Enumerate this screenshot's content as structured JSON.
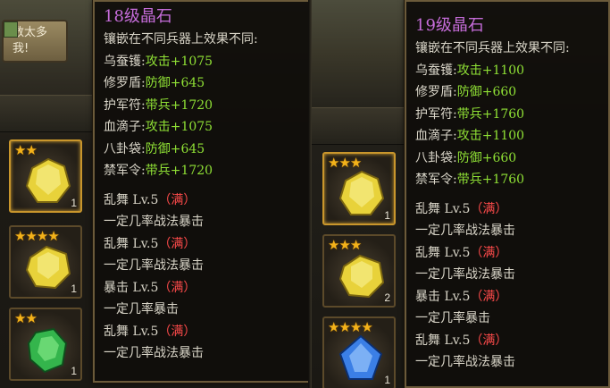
{
  "left": {
    "chat_text": "数太多我!",
    "tooltip": {
      "title": "18级晶石",
      "desc": "镶嵌在不同兵器上效果不同:",
      "effects": [
        {
          "name": "乌蚕镬:",
          "value": "攻击+1075"
        },
        {
          "name": "修罗盾:",
          "value": "防御+645"
        },
        {
          "name": "护军符:",
          "value": "带兵+1720"
        },
        {
          "name": "血滴子:",
          "value": "攻击+1075"
        },
        {
          "name": "八卦袋:",
          "value": "防御+645"
        },
        {
          "name": "禁军令:",
          "value": "带兵+1720"
        }
      ],
      "skills": [
        {
          "name": "乱舞 Lv.5",
          "full": "（满）",
          "desc": "一定几率战法暴击"
        },
        {
          "name": "乱舞 Lv.5",
          "full": "（满）",
          "desc": "一定几率战法暴击"
        },
        {
          "name": "暴击 Lv.5",
          "full": "（满）",
          "desc": "一定几率暴击"
        },
        {
          "name": "乱舞 Lv.5",
          "full": "（满）",
          "desc": "一定几率战法暴击"
        }
      ]
    },
    "slots": [
      {
        "stars": "★★",
        "count": "1",
        "gem": "yellow-gem-icon",
        "color": "#e8d23a"
      },
      {
        "stars": "★★★★",
        "count": "1",
        "gem": "yellow-gem-icon",
        "color": "#e8d23a"
      },
      {
        "stars": "★★",
        "count": "1",
        "gem": "green-gem-icon",
        "color": "#34b54c"
      }
    ]
  },
  "right": {
    "tooltip": {
      "title": "19级晶石",
      "desc": "镶嵌在不同兵器上效果不同:",
      "effects": [
        {
          "name": "乌蚕镬:",
          "value": "攻击+1100"
        },
        {
          "name": "修罗盾:",
          "value": "防御+660"
        },
        {
          "name": "护军符:",
          "value": "带兵+1760"
        },
        {
          "name": "血滴子:",
          "value": "攻击+1100"
        },
        {
          "name": "八卦袋:",
          "value": "防御+660"
        },
        {
          "name": "禁军令:",
          "value": "带兵+1760"
        }
      ],
      "skills": [
        {
          "name": "乱舞 Lv.5",
          "full": "（满）",
          "desc": "一定几率战法暴击"
        },
        {
          "name": "乱舞 Lv.5",
          "full": "（满）",
          "desc": "一定几率战法暴击"
        },
        {
          "name": "暴击 Lv.5",
          "full": "（满）",
          "desc": "一定几率暴击"
        },
        {
          "name": "乱舞 Lv.5",
          "full": "（满）",
          "desc": "一定几率战法暴击"
        }
      ]
    },
    "slots": [
      {
        "stars": "★★★",
        "count": "1",
        "gem": "yellow-gem-icon",
        "color": "#e8d23a"
      },
      {
        "stars": "★★★",
        "count": "2",
        "gem": "yellow-gem-icon",
        "color": "#e8d23a"
      },
      {
        "stars": "★★★★",
        "count": "1",
        "gem": "blue-gem-icon",
        "color": "#3b7fe6"
      }
    ]
  }
}
